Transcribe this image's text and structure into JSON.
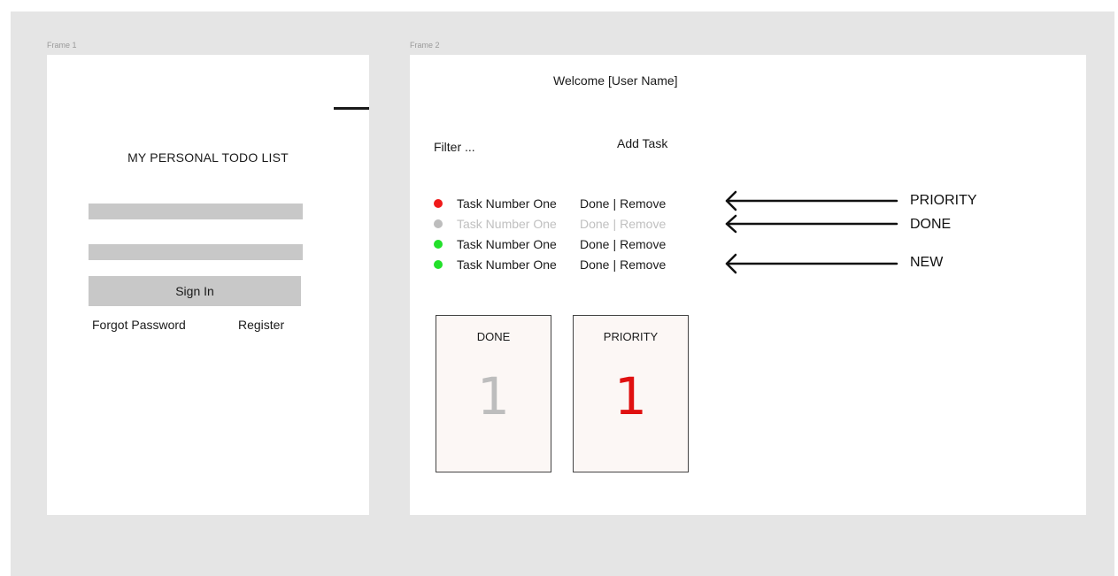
{
  "frames": {
    "frame1_label": "Frame 1",
    "frame2_label": "Frame 2"
  },
  "login": {
    "title": "MY PERSONAL TODO LIST",
    "username_value": "",
    "password_value": "",
    "sign_in_label": "Sign In",
    "forgot_label": "Forgot Password",
    "register_label": "Register"
  },
  "dashboard": {
    "welcome": "Welcome [User Name]",
    "filter_label": "Filter ...",
    "add_task_label": "Add Task",
    "tasks": [
      {
        "name": "Task Number One",
        "done_label": "Done",
        "sep": "|",
        "remove_label": "Remove",
        "status": "priority",
        "dot_color": "#f01a1a"
      },
      {
        "name": "Task Number One",
        "done_label": "Done",
        "sep": "|",
        "remove_label": "Remove",
        "status": "done",
        "dot_color": "#bdbdbd"
      },
      {
        "name": "Task Number One",
        "done_label": "Done",
        "sep": "|",
        "remove_label": "Remove",
        "status": "new",
        "dot_color": "#22e02a"
      },
      {
        "name": "Task Number One",
        "done_label": "Done",
        "sep": "|",
        "remove_label": "Remove",
        "status": "new",
        "dot_color": "#22e02a"
      }
    ],
    "cards": {
      "done": {
        "title": "DONE",
        "count": "1",
        "color": "#bdbdbd"
      },
      "priority": {
        "title": "PRIORITY",
        "count": "1",
        "color": "#e01010"
      }
    }
  },
  "annotations": {
    "priority_label": "PRIORITY",
    "done_label": "DONE",
    "new_label": "NEW"
  }
}
